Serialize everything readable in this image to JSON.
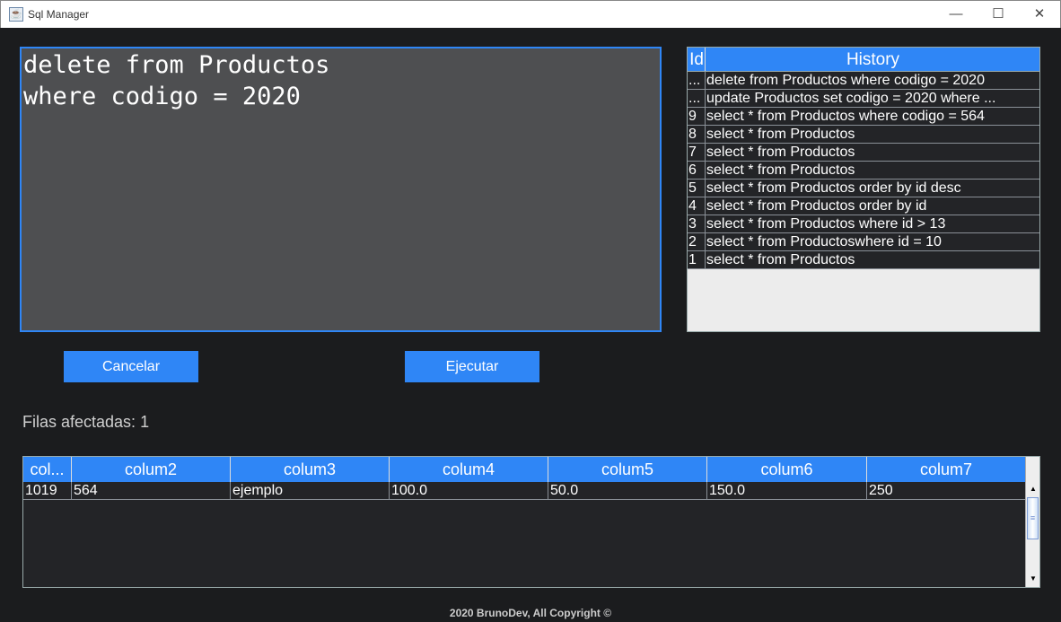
{
  "window": {
    "title": "Sql Manager",
    "icon": "java-cup-icon"
  },
  "editor": {
    "value": "delete from Productos\nwhere codigo = 2020"
  },
  "history": {
    "columns": [
      "Id",
      "History"
    ],
    "rows": [
      {
        "id": "...",
        "query": "delete from Productos  where codigo = 2020"
      },
      {
        "id": "...",
        "query": "update Productos set codigo = 2020  where ..."
      },
      {
        "id": "9",
        "query": "select * from Productos  where codigo = 564"
      },
      {
        "id": "8",
        "query": "select * from Productos"
      },
      {
        "id": "7",
        "query": "select * from Productos"
      },
      {
        "id": "6",
        "query": "select * from Productos"
      },
      {
        "id": "5",
        "query": "select * from Productos order by id desc"
      },
      {
        "id": "4",
        "query": "select * from Productos order by id"
      },
      {
        "id": "3",
        "query": "select * from Productos where id > 13"
      },
      {
        "id": "2",
        "query": "select * from Productoswhere id = 10"
      },
      {
        "id": "1",
        "query": "select * from Productos"
      }
    ]
  },
  "buttons": {
    "cancel": "Cancelar",
    "execute": "Ejecutar"
  },
  "status": {
    "affected_rows": "Filas afectadas: 1"
  },
  "results": {
    "columns": [
      "col...",
      "colum2",
      "colum3",
      "colum4",
      "colum5",
      "colum6",
      "colum7"
    ],
    "rows": [
      [
        "1019",
        "564",
        "ejemplo",
        "100.0",
        "50.0",
        "150.0",
        "250"
      ]
    ]
  },
  "footer": "2020 BrunoDev, All Copyright ©",
  "colors": {
    "accent": "#2f86f6",
    "background": "#1b1c1e",
    "editor_bg": "#4e4f51"
  }
}
